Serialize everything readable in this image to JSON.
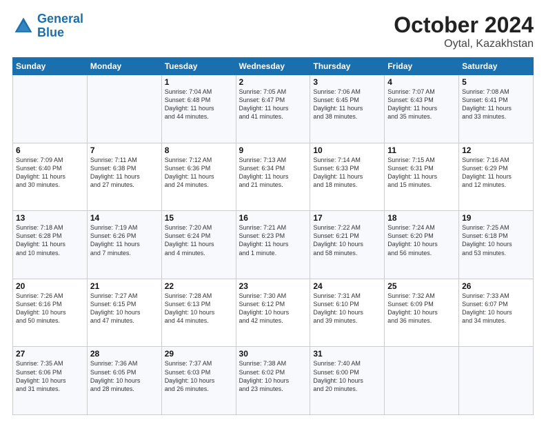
{
  "header": {
    "logo_line1": "General",
    "logo_line2": "Blue",
    "month": "October 2024",
    "location": "Oytal, Kazakhstan"
  },
  "weekdays": [
    "Sunday",
    "Monday",
    "Tuesday",
    "Wednesday",
    "Thursday",
    "Friday",
    "Saturday"
  ],
  "weeks": [
    [
      {
        "day": "",
        "content": ""
      },
      {
        "day": "",
        "content": ""
      },
      {
        "day": "1",
        "content": "Sunrise: 7:04 AM\nSunset: 6:48 PM\nDaylight: 11 hours\nand 44 minutes."
      },
      {
        "day": "2",
        "content": "Sunrise: 7:05 AM\nSunset: 6:47 PM\nDaylight: 11 hours\nand 41 minutes."
      },
      {
        "day": "3",
        "content": "Sunrise: 7:06 AM\nSunset: 6:45 PM\nDaylight: 11 hours\nand 38 minutes."
      },
      {
        "day": "4",
        "content": "Sunrise: 7:07 AM\nSunset: 6:43 PM\nDaylight: 11 hours\nand 35 minutes."
      },
      {
        "day": "5",
        "content": "Sunrise: 7:08 AM\nSunset: 6:41 PM\nDaylight: 11 hours\nand 33 minutes."
      }
    ],
    [
      {
        "day": "6",
        "content": "Sunrise: 7:09 AM\nSunset: 6:40 PM\nDaylight: 11 hours\nand 30 minutes."
      },
      {
        "day": "7",
        "content": "Sunrise: 7:11 AM\nSunset: 6:38 PM\nDaylight: 11 hours\nand 27 minutes."
      },
      {
        "day": "8",
        "content": "Sunrise: 7:12 AM\nSunset: 6:36 PM\nDaylight: 11 hours\nand 24 minutes."
      },
      {
        "day": "9",
        "content": "Sunrise: 7:13 AM\nSunset: 6:34 PM\nDaylight: 11 hours\nand 21 minutes."
      },
      {
        "day": "10",
        "content": "Sunrise: 7:14 AM\nSunset: 6:33 PM\nDaylight: 11 hours\nand 18 minutes."
      },
      {
        "day": "11",
        "content": "Sunrise: 7:15 AM\nSunset: 6:31 PM\nDaylight: 11 hours\nand 15 minutes."
      },
      {
        "day": "12",
        "content": "Sunrise: 7:16 AM\nSunset: 6:29 PM\nDaylight: 11 hours\nand 12 minutes."
      }
    ],
    [
      {
        "day": "13",
        "content": "Sunrise: 7:18 AM\nSunset: 6:28 PM\nDaylight: 11 hours\nand 10 minutes."
      },
      {
        "day": "14",
        "content": "Sunrise: 7:19 AM\nSunset: 6:26 PM\nDaylight: 11 hours\nand 7 minutes."
      },
      {
        "day": "15",
        "content": "Sunrise: 7:20 AM\nSunset: 6:24 PM\nDaylight: 11 hours\nand 4 minutes."
      },
      {
        "day": "16",
        "content": "Sunrise: 7:21 AM\nSunset: 6:23 PM\nDaylight: 11 hours\nand 1 minute."
      },
      {
        "day": "17",
        "content": "Sunrise: 7:22 AM\nSunset: 6:21 PM\nDaylight: 10 hours\nand 58 minutes."
      },
      {
        "day": "18",
        "content": "Sunrise: 7:24 AM\nSunset: 6:20 PM\nDaylight: 10 hours\nand 56 minutes."
      },
      {
        "day": "19",
        "content": "Sunrise: 7:25 AM\nSunset: 6:18 PM\nDaylight: 10 hours\nand 53 minutes."
      }
    ],
    [
      {
        "day": "20",
        "content": "Sunrise: 7:26 AM\nSunset: 6:16 PM\nDaylight: 10 hours\nand 50 minutes."
      },
      {
        "day": "21",
        "content": "Sunrise: 7:27 AM\nSunset: 6:15 PM\nDaylight: 10 hours\nand 47 minutes."
      },
      {
        "day": "22",
        "content": "Sunrise: 7:28 AM\nSunset: 6:13 PM\nDaylight: 10 hours\nand 44 minutes."
      },
      {
        "day": "23",
        "content": "Sunrise: 7:30 AM\nSunset: 6:12 PM\nDaylight: 10 hours\nand 42 minutes."
      },
      {
        "day": "24",
        "content": "Sunrise: 7:31 AM\nSunset: 6:10 PM\nDaylight: 10 hours\nand 39 minutes."
      },
      {
        "day": "25",
        "content": "Sunrise: 7:32 AM\nSunset: 6:09 PM\nDaylight: 10 hours\nand 36 minutes."
      },
      {
        "day": "26",
        "content": "Sunrise: 7:33 AM\nSunset: 6:07 PM\nDaylight: 10 hours\nand 34 minutes."
      }
    ],
    [
      {
        "day": "27",
        "content": "Sunrise: 7:35 AM\nSunset: 6:06 PM\nDaylight: 10 hours\nand 31 minutes."
      },
      {
        "day": "28",
        "content": "Sunrise: 7:36 AM\nSunset: 6:05 PM\nDaylight: 10 hours\nand 28 minutes."
      },
      {
        "day": "29",
        "content": "Sunrise: 7:37 AM\nSunset: 6:03 PM\nDaylight: 10 hours\nand 26 minutes."
      },
      {
        "day": "30",
        "content": "Sunrise: 7:38 AM\nSunset: 6:02 PM\nDaylight: 10 hours\nand 23 minutes."
      },
      {
        "day": "31",
        "content": "Sunrise: 7:40 AM\nSunset: 6:00 PM\nDaylight: 10 hours\nand 20 minutes."
      },
      {
        "day": "",
        "content": ""
      },
      {
        "day": "",
        "content": ""
      }
    ]
  ]
}
